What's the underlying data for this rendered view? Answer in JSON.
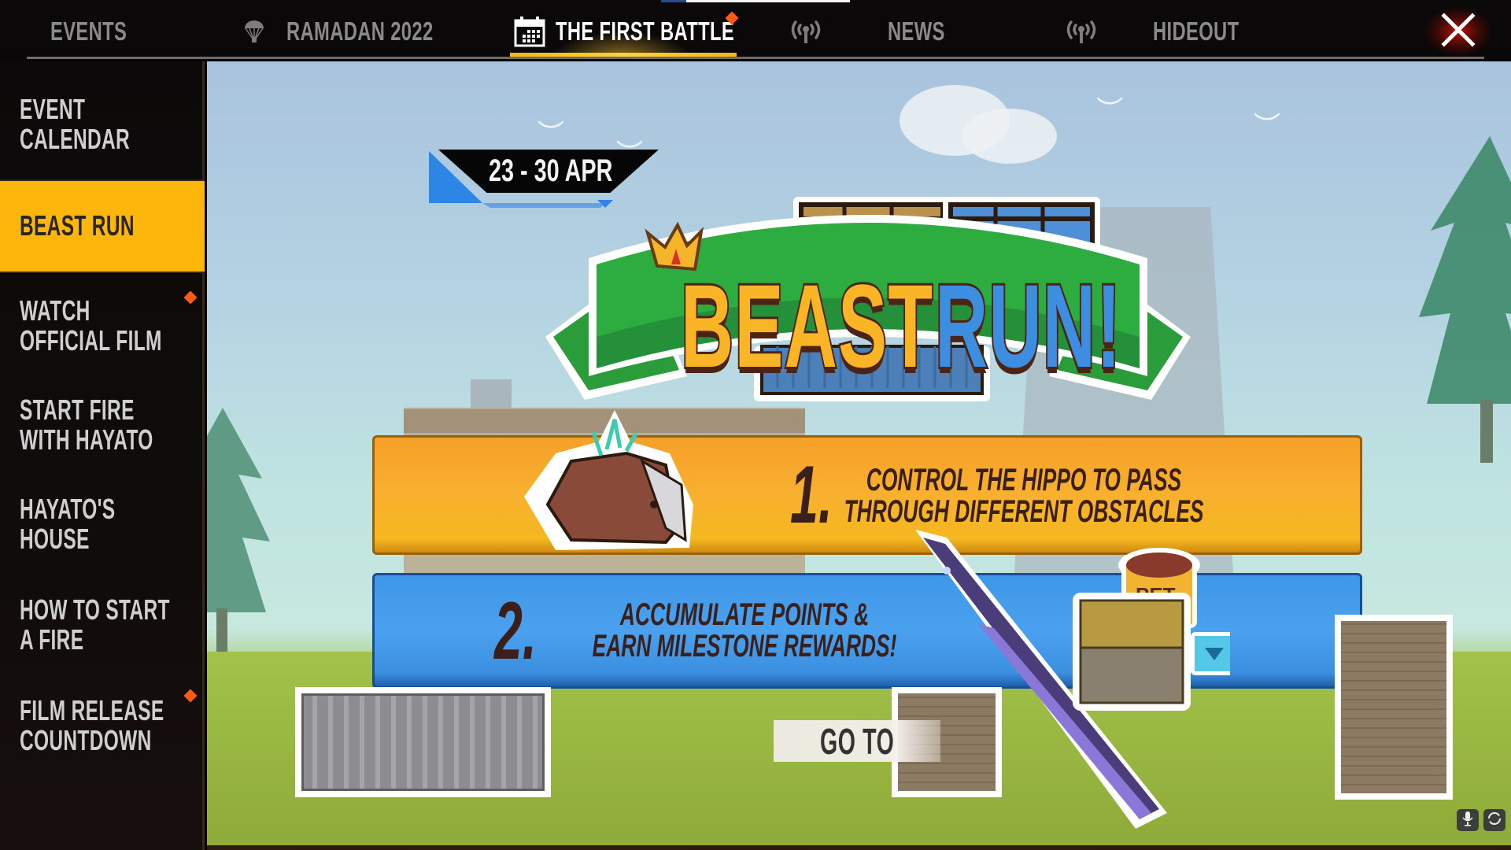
{
  "topbar": {
    "tabs": [
      {
        "label": "EVENTS",
        "icon": null,
        "active": false
      },
      {
        "label": "RAMADAN 2022",
        "icon": "parachute-icon",
        "active": false
      },
      {
        "label": "THE FIRST BATTLE",
        "icon": "calendar-icon",
        "active": true,
        "notification": true
      },
      {
        "label": "",
        "icon": "broadcast-icon",
        "active": false
      },
      {
        "label": "NEWS",
        "icon": null,
        "active": false
      },
      {
        "label": "",
        "icon": "broadcast-icon",
        "active": false
      },
      {
        "label": "HIDEOUT",
        "icon": null,
        "active": false
      }
    ],
    "close_icon": "close-icon"
  },
  "sidebar": {
    "items": [
      {
        "label": "EVENT\nCALENDAR",
        "active": false,
        "notification": false
      },
      {
        "label": "BEAST RUN",
        "active": true,
        "notification": false
      },
      {
        "label": "WATCH\nOFFICIAL FILM",
        "active": false,
        "notification": true
      },
      {
        "label": "START FIRE\nWITH HAYATO",
        "active": false,
        "notification": false
      },
      {
        "label": "HAYATO'S\nHOUSE",
        "active": false,
        "notification": false
      },
      {
        "label": "HOW TO START\nA FIRE",
        "active": false,
        "notification": false
      },
      {
        "label": "FILM RELEASE\nCOUNTDOWN",
        "active": false,
        "notification": true
      }
    ]
  },
  "main": {
    "date_range": "23 - 30 APR",
    "title_part1": "BEAST",
    "title_part2": "RUN!",
    "steps": [
      {
        "number": "1.",
        "text": "CONTROL THE HIPPO TO PASS\nTHROUGH DIFFERENT OBSTACLES"
      },
      {
        "number": "2.",
        "text": "ACCUMULATE POINTS &\nEARN MILESTONE REWARDS!"
      }
    ],
    "reward_label": "PET",
    "goto_label": "GO TO"
  },
  "corner_controls": [
    {
      "icon": "microphone-icon"
    },
    {
      "icon": "refresh-icon"
    }
  ],
  "colors": {
    "accent_yellow": "#fdb60c",
    "notification_orange": "#ff5a14",
    "step1_bg": "#f6a82a",
    "step2_bg": "#3f97e8",
    "title_gold": "#f9b525",
    "title_blue": "#3d8de0"
  }
}
